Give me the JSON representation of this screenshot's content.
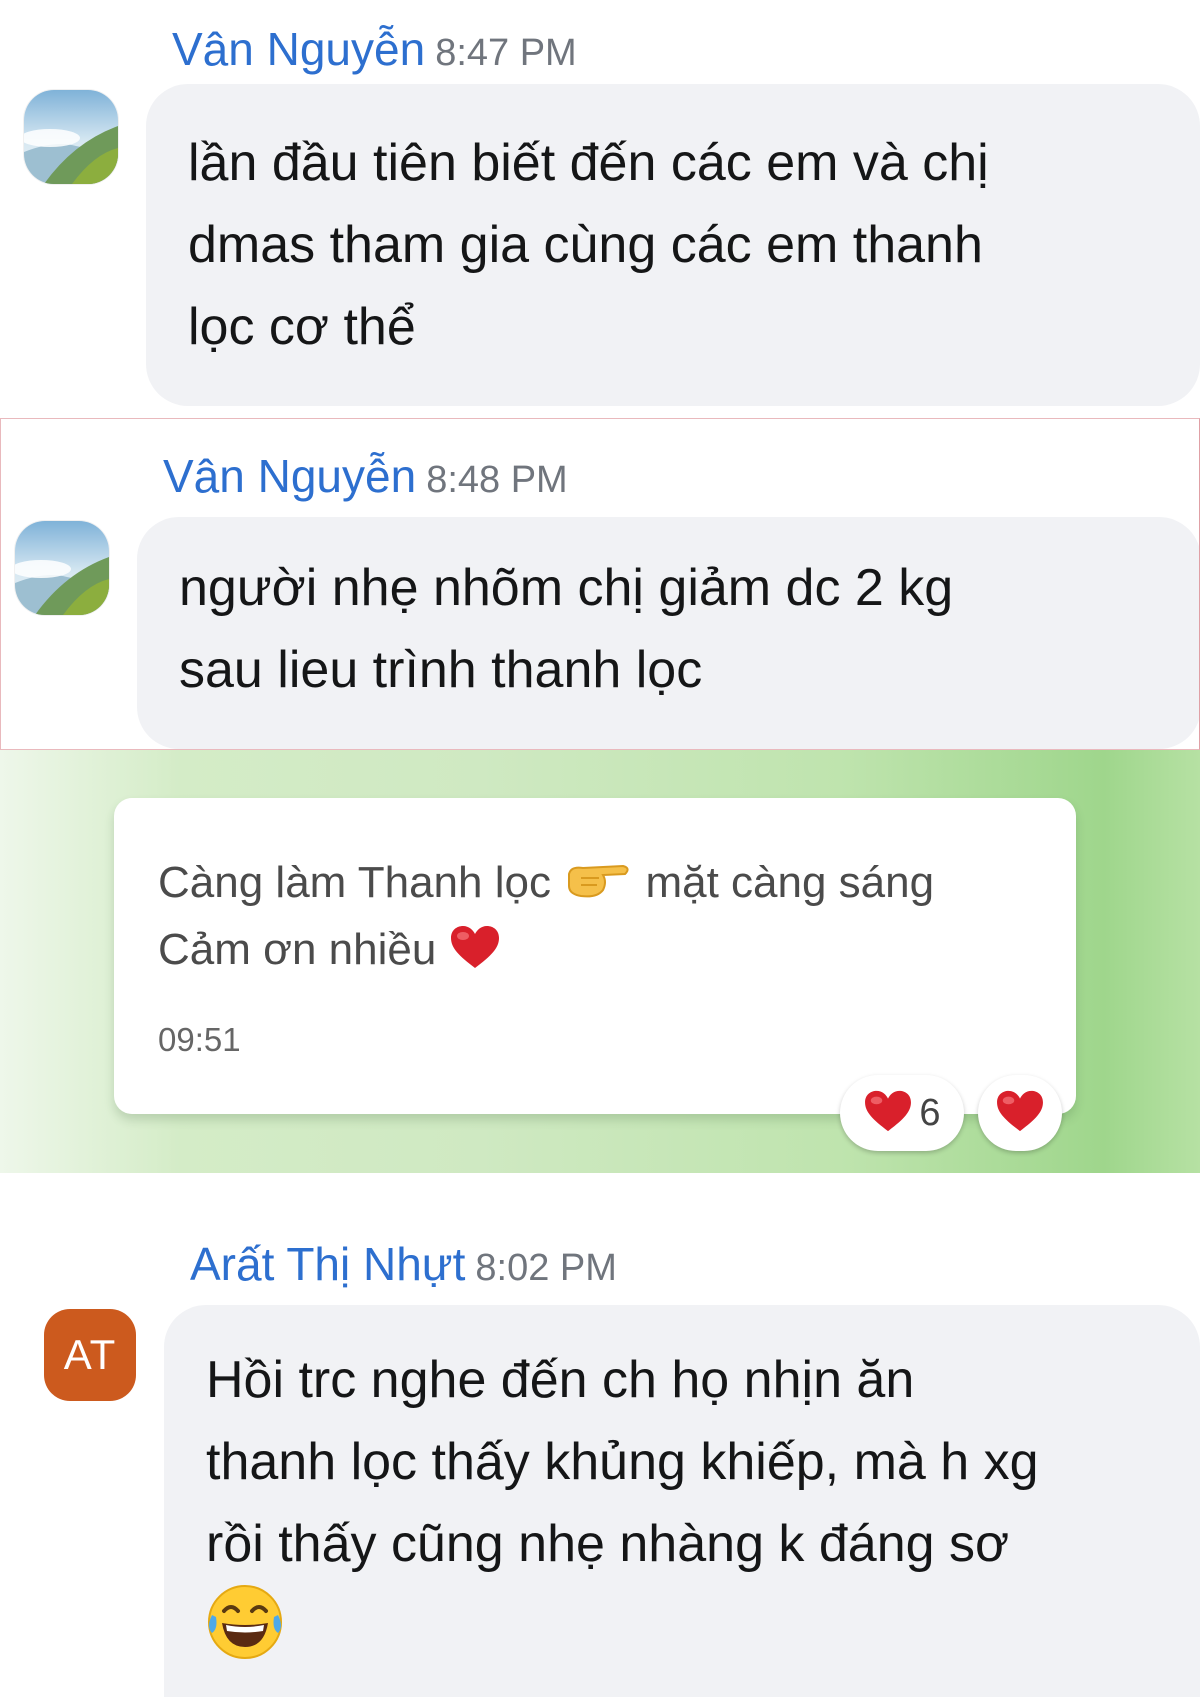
{
  "messages": [
    {
      "sender": "Vân Nguyễn",
      "time": "8:47 PM",
      "text": "lần đầu tiên biết đến các em và chị\ndmas tham gia cùng các em thanh\nlọc cơ thể"
    },
    {
      "sender": "Vân Nguyễn",
      "time": "8:48 PM",
      "text": "người nhẹ nhõm chị giảm dc 2 kg\nsau lieu trình thanh lọc"
    },
    {
      "sender": "Arất Thị Nhựt",
      "time": "8:02 PM",
      "avatar_initials": "AT",
      "text": "Hồi trc nghe đến ch họ nhịn ăn\nthanh lọc thấy khủng khiếp, mà h xg\nrồi thấy cũng nhẹ nhàng k đáng sơ",
      "emoji": "tears-of-joy-icon"
    }
  ],
  "card": {
    "line1_start": "Càng làm Thanh lọc",
    "line1_icon": "pointing-right-icon",
    "line1_end": "mặt càng sáng",
    "line2": "Cảm ơn nhiều",
    "line2_icon": "red-heart-icon",
    "time": "09:51",
    "reactions": [
      {
        "icon": "red-heart-icon",
        "count": "6"
      },
      {
        "icon": "red-heart-icon"
      }
    ]
  },
  "colors": {
    "sender_name": "#2d6fcf",
    "timestamp": "#70757d",
    "bubble": "#f1f2f5",
    "avatar_initials_bg": "#cc5a1e",
    "heart": "#d9202b"
  }
}
